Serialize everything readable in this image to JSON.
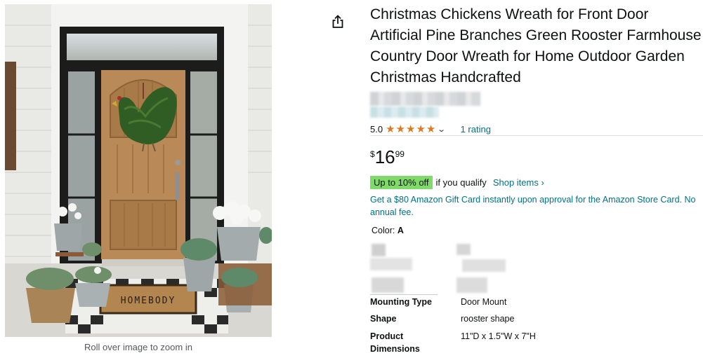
{
  "product": {
    "title": "Christmas Chickens Wreath for Front Door Artificial Pine Branches Green Rooster Farmhouse Country Door Wreath for Home Outdoor Garden Christmas Handcrafted",
    "image_alt": "Wooden front door with rooster-shaped green wreath, potted plants and HOMEBODY doormat",
    "doormat_text": "HOMEBODY",
    "zoom_hint": "Roll over image to zoom in"
  },
  "share": {
    "icon": "share-icon"
  },
  "rating": {
    "value": "5.0",
    "stars": 5,
    "count_text": "1 rating",
    "star_color": "#de7921"
  },
  "price": {
    "symbol": "$",
    "whole": "16",
    "fraction": "99"
  },
  "deal": {
    "badge": "Up to 10% off",
    "condition": "if you qualify",
    "link": "Shop items ›",
    "badge_color": "#7fda69"
  },
  "card_offer": "Get a $80 Amazon Gift Card instantly upon approval for the Amazon Store Card. No annual fee.",
  "color": {
    "label": "Color:",
    "value": "A"
  },
  "specs": [
    {
      "key": "Mounting Type",
      "value": "Door Mount"
    },
    {
      "key": "Shape",
      "value": "rooster shape"
    },
    {
      "key": "Product Dimensions",
      "value": "11\"D x 1.5\"W x 7\"H"
    }
  ],
  "colors": {
    "link": "#007185",
    "text": "#0f1111"
  }
}
